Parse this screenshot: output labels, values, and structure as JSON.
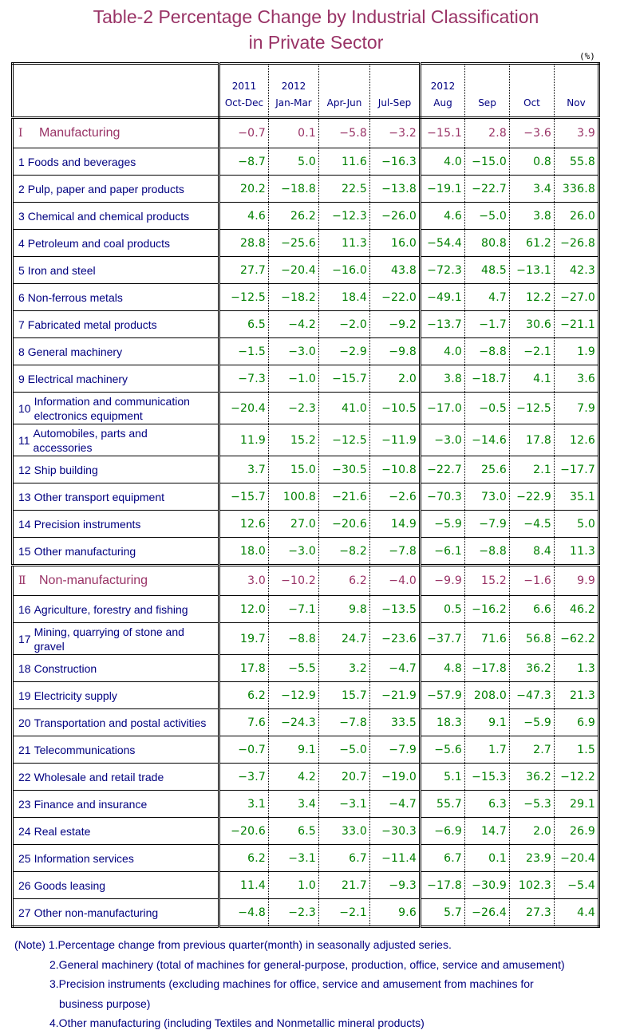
{
  "title": {
    "line1": "Table-2   Percentage Change by Industrial Classification",
    "line2": "in Private Sector"
  },
  "unit": "(%)",
  "columns": [
    {
      "year": "2011",
      "period": "Oct-Dec"
    },
    {
      "year": "2012",
      "period": "Jan-Mar"
    },
    {
      "year": "",
      "period": "Apr-Jun"
    },
    {
      "year": "",
      "period": "Jul-Sep"
    },
    {
      "year": "2012",
      "period": "Aug"
    },
    {
      "year": "",
      "period": "Sep"
    },
    {
      "year": "",
      "period": "Oct"
    },
    {
      "year": "",
      "period": "Nov"
    }
  ],
  "rows": [
    {
      "type": "section",
      "num": "Ⅰ",
      "label": "Manufacturing",
      "values": [
        "−0.7",
        "0.1",
        "−5.8",
        "−3.2",
        "−15.1",
        "2.8",
        "−3.6",
        "3.9"
      ]
    },
    {
      "type": "item",
      "num": "1",
      "label": "Foods and beverages",
      "values": [
        "−8.7",
        "5.0",
        "11.6",
        "−16.3",
        "4.0",
        "−15.0",
        "0.8",
        "55.8"
      ]
    },
    {
      "type": "item",
      "num": "2",
      "label": "Pulp, paper and paper products",
      "values": [
        "20.2",
        "−18.8",
        "22.5",
        "−13.8",
        "−19.1",
        "−22.7",
        "3.4",
        "336.8"
      ]
    },
    {
      "type": "item",
      "num": "3",
      "label": "Chemical and chemical products",
      "values": [
        "4.6",
        "26.2",
        "−12.3",
        "−26.0",
        "4.6",
        "−5.0",
        "3.8",
        "26.0"
      ]
    },
    {
      "type": "item",
      "num": "4",
      "label": "Petroleum and coal products",
      "values": [
        "28.8",
        "−25.6",
        "11.3",
        "16.0",
        "−54.4",
        "80.8",
        "61.2",
        "−26.8"
      ]
    },
    {
      "type": "item",
      "num": "5",
      "label": "Iron and steel",
      "values": [
        "27.7",
        "−20.4",
        "−16.0",
        "43.8",
        "−72.3",
        "48.5",
        "−13.1",
        "42.3"
      ]
    },
    {
      "type": "item",
      "num": "6",
      "label": "Non-ferrous metals",
      "values": [
        "−12.5",
        "−18.2",
        "18.4",
        "−22.0",
        "−49.1",
        "4.7",
        "12.2",
        "−27.0"
      ]
    },
    {
      "type": "item",
      "num": "7",
      "label": "Fabricated metal products",
      "values": [
        "6.5",
        "−4.2",
        "−2.0",
        "−9.2",
        "−13.7",
        "−1.7",
        "30.6",
        "−21.1"
      ]
    },
    {
      "type": "item",
      "num": "8",
      "label": "General machinery",
      "values": [
        "−1.5",
        "−3.0",
        "−2.9",
        "−9.8",
        "4.0",
        "−8.8",
        "−2.1",
        "1.9"
      ]
    },
    {
      "type": "item",
      "num": "9",
      "label": "Electrical machinery",
      "values": [
        "−7.3",
        "−1.0",
        "−15.7",
        "2.0",
        "3.8",
        "−18.7",
        "4.1",
        "3.6"
      ]
    },
    {
      "type": "item2",
      "num": "10",
      "label": "Information and communication electronics equipment",
      "values": [
        "−20.4",
        "−2.3",
        "41.0",
        "−10.5",
        "−17.0",
        "−0.5",
        "−12.5",
        "7.9"
      ]
    },
    {
      "type": "item2",
      "num": "11",
      "label": "Automobiles, parts and accessories",
      "values": [
        "11.9",
        "15.2",
        "−12.5",
        "−11.9",
        "−3.0",
        "−14.6",
        "17.8",
        "12.6"
      ]
    },
    {
      "type": "item",
      "num": "12",
      "label": "Ship building",
      "values": [
        "3.7",
        "15.0",
        "−30.5",
        "−10.8",
        "−22.7",
        "25.6",
        "2.1",
        "−17.7"
      ]
    },
    {
      "type": "item",
      "num": "13",
      "label": "Other transport equipment",
      "values": [
        "−15.7",
        "100.8",
        "−21.6",
        "−2.6",
        "−70.3",
        "73.0",
        "−22.9",
        "35.1"
      ]
    },
    {
      "type": "item",
      "num": "14",
      "label": "Precision instruments",
      "values": [
        "12.6",
        "27.0",
        "−20.6",
        "14.9",
        "−5.9",
        "−7.9",
        "−4.5",
        "5.0"
      ]
    },
    {
      "type": "item",
      "num": "15",
      "label": "Other manufacturing",
      "values": [
        "18.0",
        "−3.0",
        "−8.2",
        "−7.8",
        "−6.1",
        "−8.8",
        "8.4",
        "11.3"
      ]
    },
    {
      "type": "section",
      "num": "Ⅱ",
      "label": "Non-manufacturing",
      "values": [
        "3.0",
        "−10.2",
        "6.2",
        "−4.0",
        "−9.9",
        "15.2",
        "−1.6",
        "9.9"
      ]
    },
    {
      "type": "item",
      "num": "16",
      "label": "Agriculture, forestry and fishing",
      "values": [
        "12.0",
        "−7.1",
        "9.8",
        "−13.5",
        "0.5",
        "−16.2",
        "6.6",
        "46.2"
      ]
    },
    {
      "type": "item2",
      "num": "17",
      "label": "Mining, quarrying of stone and gravel",
      "values": [
        "19.7",
        "−8.8",
        "24.7",
        "−23.6",
        "−37.7",
        "71.6",
        "56.8",
        "−62.2"
      ]
    },
    {
      "type": "item",
      "num": "18",
      "label": "Construction",
      "values": [
        "17.8",
        "−5.5",
        "3.2",
        "−4.7",
        "4.8",
        "−17.8",
        "36.2",
        "1.3"
      ]
    },
    {
      "type": "item",
      "num": "19",
      "label": "Electricity supply",
      "values": [
        "6.2",
        "−12.9",
        "15.7",
        "−21.9",
        "−57.9",
        "208.0",
        "−47.3",
        "21.3"
      ]
    },
    {
      "type": "item",
      "num": "20",
      "label": "Transportation and postal activities",
      "values": [
        "7.6",
        "−24.3",
        "−7.8",
        "33.5",
        "18.3",
        "9.1",
        "−5.9",
        "6.9"
      ]
    },
    {
      "type": "item",
      "num": "21",
      "label": "Telecommunications",
      "values": [
        "−0.7",
        "9.1",
        "−5.0",
        "−7.9",
        "−5.6",
        "1.7",
        "2.7",
        "1.5"
      ]
    },
    {
      "type": "item",
      "num": "22",
      "label": "Wholesale and retail trade",
      "values": [
        "−3.7",
        "4.2",
        "20.7",
        "−19.0",
        "5.1",
        "−15.3",
        "36.2",
        "−12.2"
      ]
    },
    {
      "type": "item",
      "num": "23",
      "label": "Finance and insurance",
      "values": [
        "3.1",
        "3.4",
        "−3.1",
        "−4.7",
        "55.7",
        "6.3",
        "−5.3",
        "29.1"
      ]
    },
    {
      "type": "item",
      "num": "24",
      "label": "Real estate",
      "values": [
        "−20.6",
        "6.5",
        "33.0",
        "−30.3",
        "−6.9",
        "14.7",
        "2.0",
        "26.9"
      ]
    },
    {
      "type": "item",
      "num": "25",
      "label": "Information services",
      "values": [
        "6.2",
        "−3.1",
        "6.7",
        "−11.4",
        "6.7",
        "0.1",
        "23.9",
        "−20.4"
      ]
    },
    {
      "type": "item",
      "num": "26",
      "label": "Goods leasing",
      "values": [
        "11.4",
        "1.0",
        "21.7",
        "−9.3",
        "−17.8",
        "−30.9",
        "102.3",
        "−5.4"
      ]
    },
    {
      "type": "item",
      "num": "27",
      "label": "Other non-manufacturing",
      "values": [
        "−4.8",
        "−2.3",
        "−2.1",
        "9.6",
        "5.7",
        "−26.4",
        "27.3",
        "4.4"
      ]
    }
  ],
  "notes": {
    "prefix": "(Note)",
    "items": [
      "1.Percentage change from previous quarter(month) in seasonally adjusted series.",
      "2.General machinery (total of machines for general-purpose, production, office, service and amusement)",
      "3.Precision instruments (excluding machines for office, service and amusement from machines for",
      "business purpose)",
      "4.Other manufacturing (including Textiles and Nonmetallic mineral products)"
    ]
  },
  "colors": {
    "title": "#993366",
    "section": "#993366",
    "label": "#000080",
    "value": "#008000"
  }
}
